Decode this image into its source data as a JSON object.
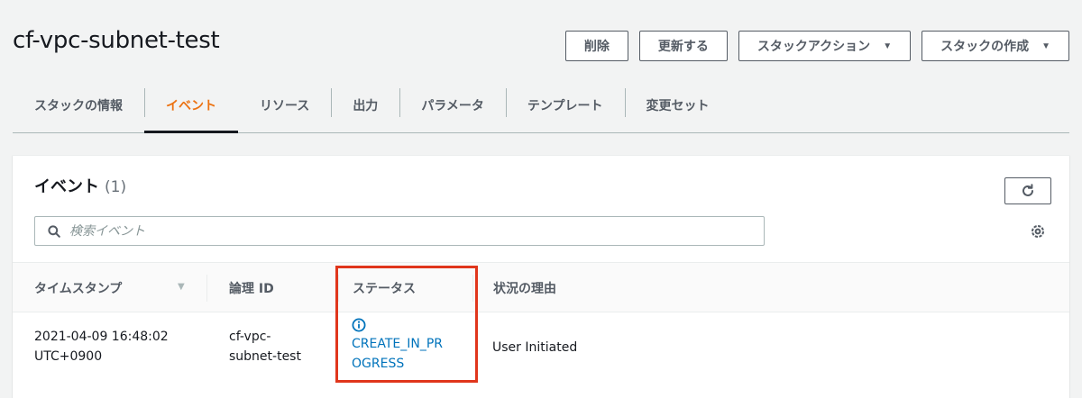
{
  "header": {
    "stack_name": "cf-vpc-subnet-test",
    "buttons": {
      "delete": "削除",
      "update": "更新する",
      "stack_actions": "スタックアクション",
      "create_stack": "スタックの作成"
    }
  },
  "tabs": [
    {
      "label": "スタックの情報",
      "active": false
    },
    {
      "label": "イベント",
      "active": true
    },
    {
      "label": "リソース",
      "active": false
    },
    {
      "label": "出力",
      "active": false
    },
    {
      "label": "パラメータ",
      "active": false
    },
    {
      "label": "テンプレート",
      "active": false
    },
    {
      "label": "変更セット",
      "active": false
    }
  ],
  "events_panel": {
    "title": "イベント",
    "count": "(1)",
    "search": {
      "placeholder": "検索イベント",
      "value": ""
    },
    "columns": {
      "timestamp": "タイムスタンプ",
      "logical_id": "論理 ID",
      "status": "ステータス",
      "reason": "状況の理由"
    },
    "rows": [
      {
        "timestamp_line1": "2021-04-09 16:48:02",
        "timestamp_line2": "UTC+0900",
        "logical_id_line1": "cf-vpc-",
        "logical_id_line2": "subnet-test",
        "status_line1": "CREATE_IN_PR",
        "status_line2": "OGRESS",
        "status_icon": "info-circle-icon",
        "reason": "User Initiated"
      }
    ]
  },
  "colors": {
    "accent_active_tab": "#ec7211",
    "status_in_progress": "#0073bb",
    "highlight_box": "#e0361c"
  }
}
